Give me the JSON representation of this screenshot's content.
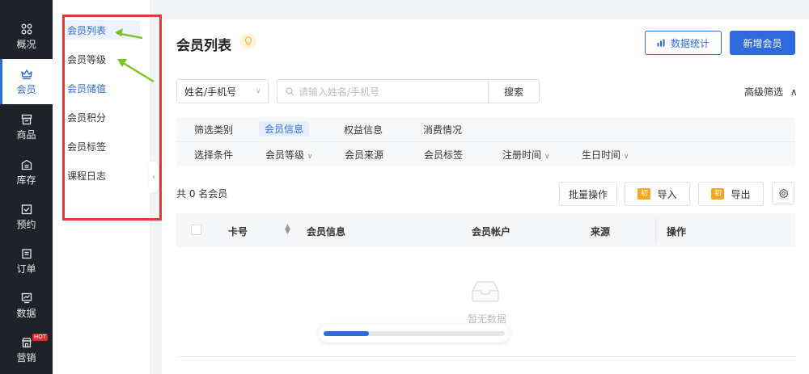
{
  "nav": {
    "items": [
      {
        "label": "概况",
        "icon": "grid-icon"
      },
      {
        "label": "会员",
        "icon": "crown-icon"
      },
      {
        "label": "商品",
        "icon": "store-icon"
      },
      {
        "label": "库存",
        "icon": "warehouse-icon"
      },
      {
        "label": "预约",
        "icon": "calendar-check-icon"
      },
      {
        "label": "订单",
        "icon": "clipboard-icon"
      },
      {
        "label": "数据",
        "icon": "monitor-chart-icon"
      },
      {
        "label": "营销",
        "icon": "shop-icon"
      }
    ],
    "hot_badge": "HOT",
    "active_index": 1
  },
  "submenu": {
    "items": [
      "会员列表",
      "会员等级",
      "会员储值",
      "会员积分",
      "会员标签",
      "课程日志"
    ],
    "active": "会员列表"
  },
  "header": {
    "title": "会员列表",
    "stats_button": "数据统计",
    "add_button": "新增会员"
  },
  "search": {
    "field_select": "姓名/手机号",
    "placeholder": "请输入姓名/手机号",
    "search_button": "搜索",
    "advanced_filter": "高级筛选"
  },
  "filter": {
    "category_label": "筛选类别",
    "categories": [
      "会员信息",
      "权益信息",
      "消费情况"
    ],
    "active_category": "会员信息",
    "condition_label": "选择条件",
    "conditions": [
      "会员等级",
      "会员来源",
      "会员标签",
      "注册时间",
      "生日时间"
    ]
  },
  "toolbar": {
    "total_text": "共 0 名会员",
    "batch_button": "批量操作",
    "import_button": "导入",
    "export_button": "导出",
    "import_badge": "初",
    "export_badge": "初"
  },
  "table": {
    "columns": [
      "卡号",
      "会员信息",
      "会员帐户",
      "来源",
      "操作"
    ],
    "empty_text": "暂无数据"
  },
  "loading": {
    "progress": 0.25
  },
  "colors": {
    "accent": "#2f6bde",
    "nav_bg": "#1f2329",
    "annotation_red": "#e53935",
    "annotation_arrow": "#7cc21e"
  }
}
